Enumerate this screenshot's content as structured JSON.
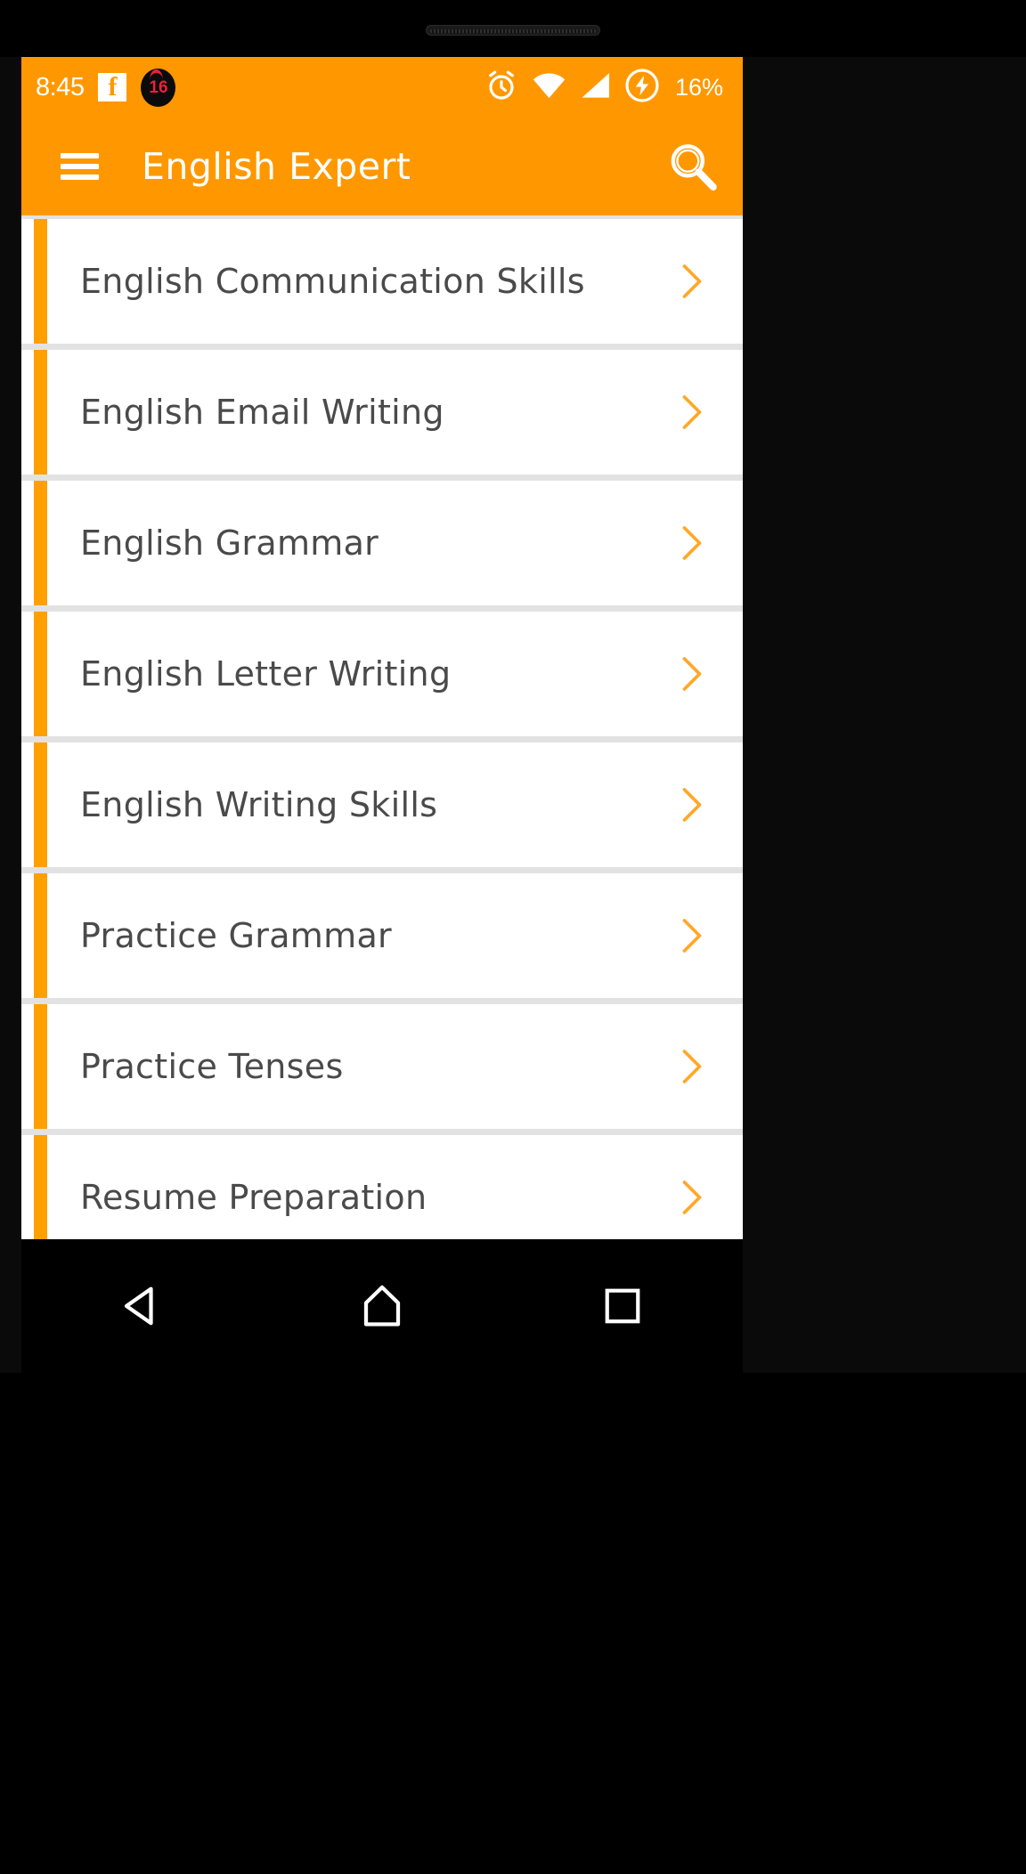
{
  "status_bar": {
    "time": "8:45",
    "facebook_icon": "facebook-icon",
    "notification_badge_count": "16",
    "alarm_icon": "alarm-clock-icon",
    "wifi_icon": "wifi-icon",
    "signal_icon": "cellular-signal-icon",
    "charging_icon": "battery-charging-icon",
    "battery_percent": "16%",
    "background_color": "#FF9800"
  },
  "app_bar": {
    "menu_icon": "hamburger-menu-icon",
    "title": "English Expert",
    "search_icon": "search-icon",
    "background_color": "#FF9800",
    "title_color": "#FFFFFF"
  },
  "list": {
    "accent_color": "#FFA000",
    "card_color": "#FFFFFF",
    "background_color": "#E2E2E2",
    "text_color": "#4A4A4A",
    "items": [
      {
        "label": "English Communication Skills",
        "chevron": "chevron-right-icon"
      },
      {
        "label": "English Email Writing",
        "chevron": "chevron-right-icon"
      },
      {
        "label": "English Grammar",
        "chevron": "chevron-right-icon"
      },
      {
        "label": "English Letter Writing",
        "chevron": "chevron-right-icon"
      },
      {
        "label": "English Writing Skills",
        "chevron": "chevron-right-icon"
      },
      {
        "label": "Practice Grammar",
        "chevron": "chevron-right-icon"
      },
      {
        "label": "Practice Tenses",
        "chevron": "chevron-right-icon"
      },
      {
        "label": "Resume Preparation",
        "chevron": "chevron-right-icon"
      }
    ]
  },
  "nav_bar": {
    "back_icon": "back-triangle-icon",
    "home_icon": "home-icon",
    "recents_icon": "recents-square-icon",
    "background_color": "#000000"
  }
}
